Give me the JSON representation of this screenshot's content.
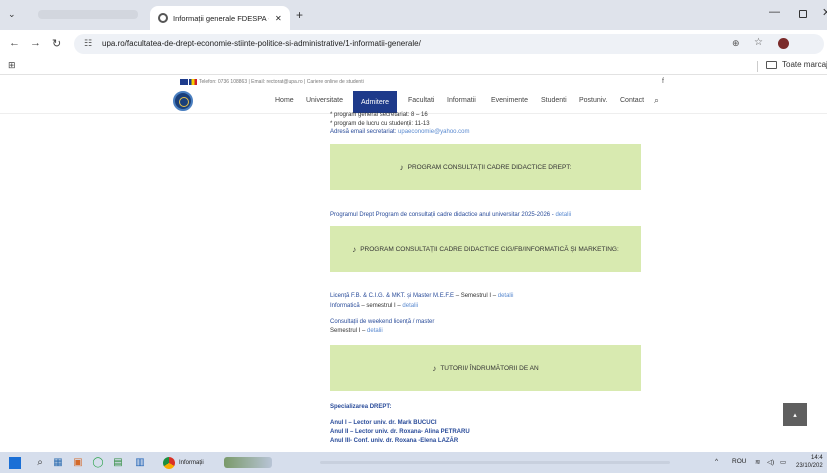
{
  "browser": {
    "tab_title": "Informații generale FDESPA - U",
    "tab_close": "✕",
    "new_tab": "+",
    "url": "upa.ro/facultatea-de-drept-economie-stiinte-politice-si-administrative/1-informatii-generale/",
    "bookmarks_folder": "Toate marcajele"
  },
  "site": {
    "topbar_text": "Telefon: 0736 108863 | Email: rectorat@upa.ro | Cariere online de studenti",
    "topbar_social": "f",
    "nav": {
      "home": "Home",
      "universitate": "Universitate",
      "admitere": "Admitere",
      "facultati": "Facultati",
      "informatii": "Informatii",
      "evenimente": "Evenimente",
      "studenti": "Studenti",
      "postuniv": "Postuniv.",
      "contact": "Contact"
    }
  },
  "content": {
    "sched1": "* program general secretariat: 8 – 16",
    "sched2": "* program de lucru cu studenții: 11-13",
    "email_label": "Adresă email secretariat:",
    "email_value": "upaeconomie@yahoo.com",
    "box1": "PROGRAM CONSULTAȚII CADRE DIDACTICE DREPT:",
    "drept_line": "Programul Drept Program de consultații cadre didactice  anul universitar 2025-2026 -",
    "detalii": "detalii",
    "box2": "PROGRAM CONSULTAȚII CADRE DIDACTICE CIG/FB/INFORMATICĂ ȘI MARKETING:",
    "licenta_line": "Licență F.B. & C.I.G. & MKT. și Master M.E.F.E",
    "licenta_sem": "– Semestrul I –",
    "informatica": "Informatică",
    "informatica_sem": "– semestrul I –",
    "weekend_title": "Consultații de weekend licență / master",
    "weekend_sem": "Semestrul I –",
    "box3": "TUTORII/ ÎNDRUMĂTORII DE AN",
    "spec_title": "Specializarea DREPT:",
    "anul1": "Anul I – Lector univ. dr. Mark BUCUCI",
    "anul2": "Anul II – Lector univ. dr. Roxana- Alina PETRARU",
    "anul3": "Anul III- Conf. univ. dr. Roxana -Elena LAZĂR"
  },
  "taskbar": {
    "chrome_label": "Informații",
    "lang": "ROU",
    "time": "14:4",
    "date": "23/10/202"
  }
}
